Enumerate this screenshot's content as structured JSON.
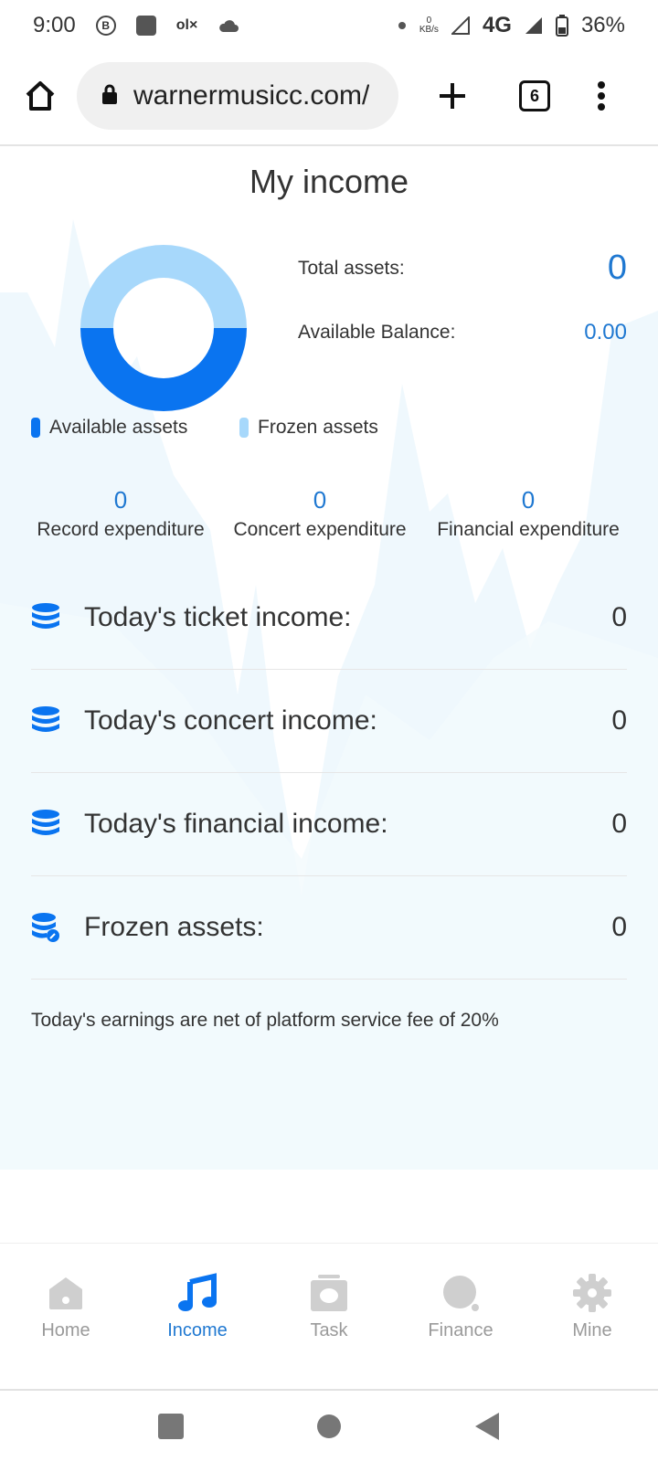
{
  "status_bar": {
    "time": "9:00",
    "net_speed_value": "0",
    "net_speed_unit": "KB/s",
    "network": "4G",
    "battery": "36%"
  },
  "browser": {
    "url": "warnermusicc.com/",
    "tab_count": "6"
  },
  "page": {
    "title": "My income",
    "total_assets_label": "Total assets:",
    "total_assets_value": "0",
    "available_balance_label": "Available Balance:",
    "available_balance_value": "0.00",
    "legend": [
      {
        "label": "Available assets",
        "color": "#0a74f0"
      },
      {
        "label": "Frozen assets",
        "color": "#a7d8fb"
      }
    ],
    "donut": {
      "available_fraction": 0.5,
      "frozen_fraction": 0.5
    },
    "expenditures": [
      {
        "value": "0",
        "label": "Record expenditure"
      },
      {
        "value": "0",
        "label": "Concert expenditure"
      },
      {
        "value": "0",
        "label": "Financial expenditure"
      }
    ],
    "income_rows": [
      {
        "label": "Today's ticket income:",
        "value": "0",
        "icon": "database-icon"
      },
      {
        "label": "Today's concert income:",
        "value": "0",
        "icon": "database-icon"
      },
      {
        "label": "Today's financial income:",
        "value": "0",
        "icon": "database-icon"
      },
      {
        "label": "Frozen assets:",
        "value": "0",
        "icon": "database-edit-icon"
      }
    ],
    "note": "Today's earnings are net of platform service fee of 20%"
  },
  "tabbar": {
    "items": [
      {
        "label": "Home",
        "icon": "home-icon",
        "active": false
      },
      {
        "label": "Income",
        "icon": "music-note-icon",
        "active": true
      },
      {
        "label": "Task",
        "icon": "task-icon",
        "active": false
      },
      {
        "label": "Finance",
        "icon": "finance-icon",
        "active": false
      },
      {
        "label": "Mine",
        "icon": "gear-icon",
        "active": false
      }
    ]
  },
  "colors": {
    "accent": "#1f78d1",
    "donut_available": "#0a74f0",
    "donut_frozen": "#a7d8fb",
    "inactive": "#9a9a9a"
  }
}
